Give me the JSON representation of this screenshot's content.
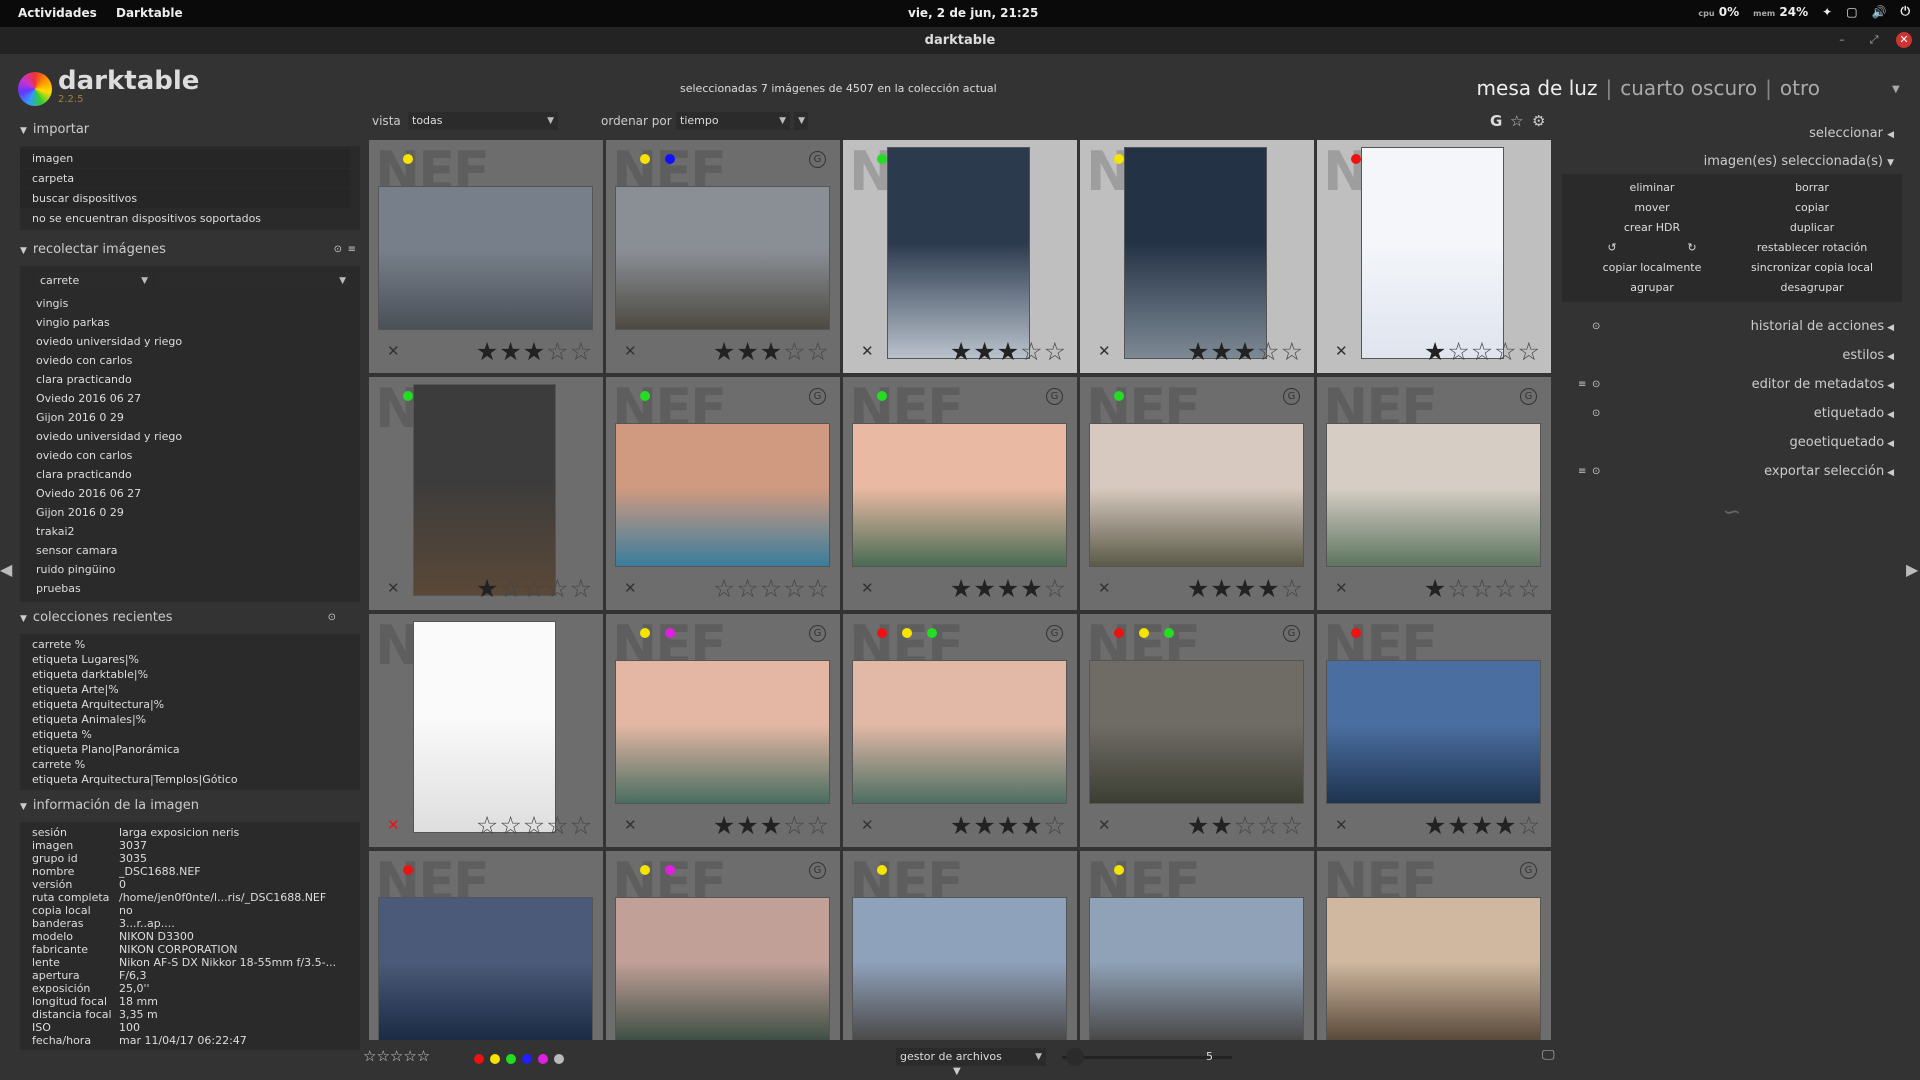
{
  "topbar": {
    "activities": "Actividades",
    "app": "Darktable",
    "clock": "vie,  2 de jun, 21:25",
    "cpu": "0%",
    "mem": "24%"
  },
  "window": {
    "title": "darktable"
  },
  "header": {
    "logo": "darktable",
    "version": "2.2.5",
    "status": "seleccionadas 7 imágenes de 4507 en la colección actual",
    "view_active": "mesa de luz",
    "view_2": "cuarto oscuro",
    "view_3": "otro"
  },
  "left": {
    "import": {
      "title": "importar",
      "items": [
        "imagen",
        "carpeta",
        "buscar dispositivos",
        "no se encuentran dispositivos soportados"
      ]
    },
    "collect": {
      "title": "recolectar imágenes",
      "combo": "carrete",
      "items": [
        "vingis",
        "vingio parkas",
        "oviedo universidad y riego",
        "oviedo con carlos",
        "clara practicando",
        "Oviedo 2016 06 27",
        "Gijon 2016 0 29",
        "oviedo universidad y riego",
        "oviedo con carlos",
        "clara practicando",
        "Oviedo 2016 06 27",
        "Gijon 2016 0 29",
        "trakai2",
        "sensor camara",
        "ruido pingüino",
        "pruebas"
      ]
    },
    "recent": {
      "title": "colecciones recientes",
      "items": [
        "carrete %",
        "etiqueta Lugares|%",
        "etiqueta darktable|%",
        "etiqueta Arte|%",
        "etiqueta Arquitectura|%",
        "etiqueta Animales|%",
        "etiqueta %",
        "etiqueta Plano|Panorámica",
        "carrete %",
        "etiqueta Arquitectura|Templos|Gótico"
      ]
    },
    "info": {
      "title": "información de la imagen",
      "rows": [
        {
          "k": "sesión",
          "v": "larga exposicion neris"
        },
        {
          "k": "imagen",
          "v": "3037"
        },
        {
          "k": "grupo id",
          "v": "3035"
        },
        {
          "k": "nombre",
          "v": "_DSC1688.NEF"
        },
        {
          "k": "versión",
          "v": "0"
        },
        {
          "k": "ruta completa",
          "v": "/home/jen0f0nte/l...ris/_DSC1688.NEF"
        },
        {
          "k": "copia local",
          "v": "no"
        },
        {
          "k": "banderas",
          "v": "3...r..ap...."
        },
        {
          "k": "modelo",
          "v": "NIKON D3300"
        },
        {
          "k": "fabricante",
          "v": "NIKON CORPORATION"
        },
        {
          "k": "lente",
          "v": "Nikon AF-S DX Nikkor 18-55mm f/3.5-..."
        },
        {
          "k": "apertura",
          "v": "F/6,3"
        },
        {
          "k": "exposición",
          "v": "25,0''"
        },
        {
          "k": "longitud focal",
          "v": "18 mm"
        },
        {
          "k": "distancia focal",
          "v": "3,35 m"
        },
        {
          "k": "ISO",
          "v": "100"
        },
        {
          "k": "fecha/hora",
          "v": "mar 11/04/17 06:22:47"
        }
      ]
    }
  },
  "toolbar": {
    "view_label": "vista",
    "view_value": "todas",
    "sort_label": "ordenar por",
    "sort_value": "tiempo",
    "g": "G"
  },
  "grid": {
    "nef": "NEF",
    "cells": [
      {
        "dots": [
          "#f5e400"
        ],
        "stars": 3,
        "grp": false,
        "sel": false,
        "rej": false,
        "colors": [
          "#777f8a",
          "#4a5058"
        ],
        "portrait": false
      },
      {
        "dots": [
          "#f5e400",
          "#1010ff"
        ],
        "stars": 3,
        "grp": true,
        "sel": false,
        "rej": false,
        "colors": [
          "#8a8e95",
          "#4c4a42"
        ],
        "portrait": false
      },
      {
        "dots": [
          "#22dd22"
        ],
        "stars": 3,
        "grp": false,
        "sel": true,
        "rej": false,
        "colors": [
          "#2c3a4e",
          "#b9c2cc"
        ],
        "portrait": true
      },
      {
        "dots": [
          "#f5e400"
        ],
        "stars": 3,
        "grp": false,
        "sel": true,
        "rej": false,
        "colors": [
          "#243246",
          "#7d8994"
        ],
        "portrait": true
      },
      {
        "dots": [
          "#ee1111"
        ],
        "stars": 1,
        "grp": false,
        "sel": true,
        "rej": false,
        "colors": [
          "#f4f6fa",
          "#dfe4ee"
        ],
        "portrait": true
      },
      {
        "dots": [
          "#22dd22"
        ],
        "stars": 1,
        "grp": false,
        "sel": false,
        "rej": false,
        "colors": [
          "#3c3c3c",
          "#5a4838"
        ],
        "portrait": true
      },
      {
        "dots": [
          "#22dd22"
        ],
        "stars": 0,
        "grp": true,
        "sel": false,
        "rej": false,
        "colors": [
          "#d09a80",
          "#3a7d9c"
        ],
        "portrait": false
      },
      {
        "dots": [
          "#22dd22"
        ],
        "stars": 4,
        "grp": true,
        "sel": false,
        "rej": false,
        "colors": [
          "#e9b9a3",
          "#4b6c55"
        ],
        "portrait": false
      },
      {
        "dots": [
          "#22dd22"
        ],
        "stars": 4,
        "grp": true,
        "sel": false,
        "rej": false,
        "colors": [
          "#d7c9bf",
          "#5b5a48"
        ],
        "portrait": false
      },
      {
        "dots": [],
        "stars": 1,
        "grp": true,
        "sel": false,
        "rej": false,
        "colors": [
          "#d6cec4",
          "#5e7560"
        ],
        "portrait": false
      },
      {
        "dots": [],
        "stars": 0,
        "grp": false,
        "sel": false,
        "rej": true,
        "colors": [
          "#fafafa",
          "#dedede"
        ],
        "portrait": true
      },
      {
        "dots": [
          "#f5e400",
          "#e020e0"
        ],
        "stars": 3,
        "grp": true,
        "sel": false,
        "rej": false,
        "colors": [
          "#e3b7a4",
          "#4a6d60"
        ],
        "portrait": false
      },
      {
        "dots": [
          "#ee1111",
          "#f5e400",
          "#22dd22"
        ],
        "stars": 4,
        "grp": true,
        "sel": false,
        "rej": false,
        "colors": [
          "#e2b8a6",
          "#4d6f62"
        ],
        "portrait": false
      },
      {
        "dots": [
          "#ee1111",
          "#f5e400",
          "#22dd22"
        ],
        "stars": 2,
        "grp": true,
        "sel": false,
        "rej": false,
        "colors": [
          "#6f6c66",
          "#3c3e33"
        ],
        "portrait": false
      },
      {
        "dots": [
          "#ee1111"
        ],
        "stars": 4,
        "grp": false,
        "sel": false,
        "rej": false,
        "colors": [
          "#4a6ea0",
          "#1f3450"
        ],
        "portrait": false
      },
      {
        "dots": [
          "#ee1111"
        ],
        "stars": 0,
        "grp": false,
        "sel": false,
        "rej": false,
        "colors": [
          "#4a5a78",
          "#1b2b45"
        ],
        "portrait": false
      },
      {
        "dots": [
          "#f5e400",
          "#e020e0"
        ],
        "stars": 0,
        "grp": true,
        "sel": false,
        "rej": false,
        "colors": [
          "#c1a098",
          "#3f4f45"
        ],
        "portrait": false
      },
      {
        "dots": [
          "#f5e400"
        ],
        "stars": 0,
        "grp": false,
        "sel": false,
        "rej": false,
        "colors": [
          "#8fa2bb",
          "#4c4a4a"
        ],
        "portrait": false
      },
      {
        "dots": [
          "#f5e400"
        ],
        "stars": 0,
        "grp": false,
        "sel": false,
        "rej": false,
        "colors": [
          "#90a2b8",
          "#4a4848"
        ],
        "portrait": false
      },
      {
        "dots": [],
        "stars": 0,
        "grp": true,
        "sel": false,
        "rej": false,
        "colors": [
          "#d0b8a0",
          "#5a4a3a"
        ],
        "portrait": false
      }
    ]
  },
  "right": {
    "select": "seleccionar",
    "selected": "imagen(es) seleccionada(s)",
    "buttons": [
      "eliminar",
      "borrar",
      "mover",
      "copiar",
      "crear HDR",
      "duplicar",
      "↺",
      "↻",
      "restablecer rotación",
      "copiar localmente",
      "sincronizar copia local",
      "agrupar",
      "desagrupar"
    ],
    "modules": [
      "historial de acciones",
      "estilos",
      "editor de metadatos",
      "etiquetado",
      "geoetiquetado",
      "exportar selección"
    ]
  },
  "bottom": {
    "stars": "☆☆☆☆☆",
    "colors": [
      "#ee1111",
      "#f5e400",
      "#22dd22",
      "#2020ff",
      "#e020e0",
      "#bbbbbb"
    ],
    "mode": "gestor de archivos",
    "zoom": "5"
  }
}
